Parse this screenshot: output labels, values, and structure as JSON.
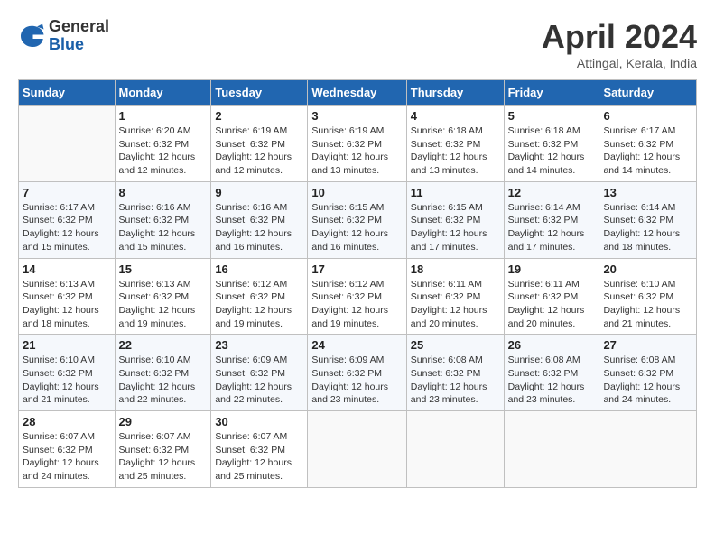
{
  "header": {
    "logo_general": "General",
    "logo_blue": "Blue",
    "month_year": "April 2024",
    "location": "Attingal, Kerala, India"
  },
  "weekdays": [
    "Sunday",
    "Monday",
    "Tuesday",
    "Wednesday",
    "Thursday",
    "Friday",
    "Saturday"
  ],
  "weeks": [
    [
      {
        "num": "",
        "detail": ""
      },
      {
        "num": "1",
        "detail": "Sunrise: 6:20 AM\nSunset: 6:32 PM\nDaylight: 12 hours\nand 12 minutes."
      },
      {
        "num": "2",
        "detail": "Sunrise: 6:19 AM\nSunset: 6:32 PM\nDaylight: 12 hours\nand 12 minutes."
      },
      {
        "num": "3",
        "detail": "Sunrise: 6:19 AM\nSunset: 6:32 PM\nDaylight: 12 hours\nand 13 minutes."
      },
      {
        "num": "4",
        "detail": "Sunrise: 6:18 AM\nSunset: 6:32 PM\nDaylight: 12 hours\nand 13 minutes."
      },
      {
        "num": "5",
        "detail": "Sunrise: 6:18 AM\nSunset: 6:32 PM\nDaylight: 12 hours\nand 14 minutes."
      },
      {
        "num": "6",
        "detail": "Sunrise: 6:17 AM\nSunset: 6:32 PM\nDaylight: 12 hours\nand 14 minutes."
      }
    ],
    [
      {
        "num": "7",
        "detail": "Sunrise: 6:17 AM\nSunset: 6:32 PM\nDaylight: 12 hours\nand 15 minutes."
      },
      {
        "num": "8",
        "detail": "Sunrise: 6:16 AM\nSunset: 6:32 PM\nDaylight: 12 hours\nand 15 minutes."
      },
      {
        "num": "9",
        "detail": "Sunrise: 6:16 AM\nSunset: 6:32 PM\nDaylight: 12 hours\nand 16 minutes."
      },
      {
        "num": "10",
        "detail": "Sunrise: 6:15 AM\nSunset: 6:32 PM\nDaylight: 12 hours\nand 16 minutes."
      },
      {
        "num": "11",
        "detail": "Sunrise: 6:15 AM\nSunset: 6:32 PM\nDaylight: 12 hours\nand 17 minutes."
      },
      {
        "num": "12",
        "detail": "Sunrise: 6:14 AM\nSunset: 6:32 PM\nDaylight: 12 hours\nand 17 minutes."
      },
      {
        "num": "13",
        "detail": "Sunrise: 6:14 AM\nSunset: 6:32 PM\nDaylight: 12 hours\nand 18 minutes."
      }
    ],
    [
      {
        "num": "14",
        "detail": "Sunrise: 6:13 AM\nSunset: 6:32 PM\nDaylight: 12 hours\nand 18 minutes."
      },
      {
        "num": "15",
        "detail": "Sunrise: 6:13 AM\nSunset: 6:32 PM\nDaylight: 12 hours\nand 19 minutes."
      },
      {
        "num": "16",
        "detail": "Sunrise: 6:12 AM\nSunset: 6:32 PM\nDaylight: 12 hours\nand 19 minutes."
      },
      {
        "num": "17",
        "detail": "Sunrise: 6:12 AM\nSunset: 6:32 PM\nDaylight: 12 hours\nand 19 minutes."
      },
      {
        "num": "18",
        "detail": "Sunrise: 6:11 AM\nSunset: 6:32 PM\nDaylight: 12 hours\nand 20 minutes."
      },
      {
        "num": "19",
        "detail": "Sunrise: 6:11 AM\nSunset: 6:32 PM\nDaylight: 12 hours\nand 20 minutes."
      },
      {
        "num": "20",
        "detail": "Sunrise: 6:10 AM\nSunset: 6:32 PM\nDaylight: 12 hours\nand 21 minutes."
      }
    ],
    [
      {
        "num": "21",
        "detail": "Sunrise: 6:10 AM\nSunset: 6:32 PM\nDaylight: 12 hours\nand 21 minutes."
      },
      {
        "num": "22",
        "detail": "Sunrise: 6:10 AM\nSunset: 6:32 PM\nDaylight: 12 hours\nand 22 minutes."
      },
      {
        "num": "23",
        "detail": "Sunrise: 6:09 AM\nSunset: 6:32 PM\nDaylight: 12 hours\nand 22 minutes."
      },
      {
        "num": "24",
        "detail": "Sunrise: 6:09 AM\nSunset: 6:32 PM\nDaylight: 12 hours\nand 23 minutes."
      },
      {
        "num": "25",
        "detail": "Sunrise: 6:08 AM\nSunset: 6:32 PM\nDaylight: 12 hours\nand 23 minutes."
      },
      {
        "num": "26",
        "detail": "Sunrise: 6:08 AM\nSunset: 6:32 PM\nDaylight: 12 hours\nand 23 minutes."
      },
      {
        "num": "27",
        "detail": "Sunrise: 6:08 AM\nSunset: 6:32 PM\nDaylight: 12 hours\nand 24 minutes."
      }
    ],
    [
      {
        "num": "28",
        "detail": "Sunrise: 6:07 AM\nSunset: 6:32 PM\nDaylight: 12 hours\nand 24 minutes."
      },
      {
        "num": "29",
        "detail": "Sunrise: 6:07 AM\nSunset: 6:32 PM\nDaylight: 12 hours\nand 25 minutes."
      },
      {
        "num": "30",
        "detail": "Sunrise: 6:07 AM\nSunset: 6:32 PM\nDaylight: 12 hours\nand 25 minutes."
      },
      {
        "num": "",
        "detail": ""
      },
      {
        "num": "",
        "detail": ""
      },
      {
        "num": "",
        "detail": ""
      },
      {
        "num": "",
        "detail": ""
      }
    ]
  ]
}
